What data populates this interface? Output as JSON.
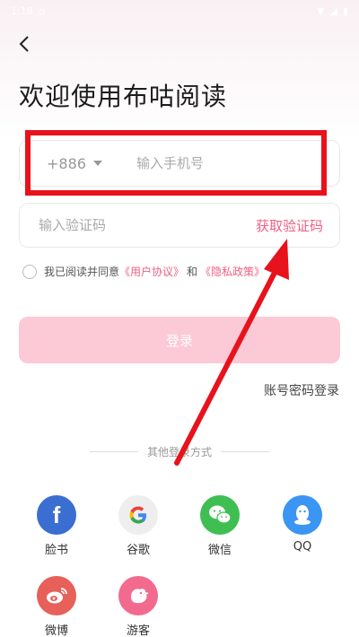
{
  "status_bar": {
    "time": "1:18"
  },
  "header": {
    "title": "欢迎使用布咕阅读"
  },
  "phone": {
    "country_code": "+886",
    "placeholder": "输入手机号"
  },
  "code": {
    "placeholder": "输入验证码",
    "get_code_label": "获取验证码"
  },
  "agreement": {
    "prefix": "我已阅读并同意",
    "user_agreement": "《用户协议》",
    "and": "和",
    "privacy_policy": "《隐私政策》"
  },
  "login_button": "登录",
  "password_login": "账号密码登录",
  "other_methods_label": "其他登录方式",
  "social": [
    {
      "name": "facebook-icon",
      "label": "脸书",
      "color": "#3b6ed1"
    },
    {
      "name": "google-icon",
      "label": "谷歌",
      "color": "#eeeeee"
    },
    {
      "name": "wechat-icon",
      "label": "微信",
      "color": "#3fbf52"
    },
    {
      "name": "qq-icon",
      "label": "QQ",
      "color": "#3a95f3"
    },
    {
      "name": "weibo-icon",
      "label": "微博",
      "color": "#e8605a"
    },
    {
      "name": "guest-icon",
      "label": "游客",
      "color": "#f26b8f"
    }
  ],
  "colors": {
    "accent": "#ee5f85",
    "annotation": "#e8121c",
    "button_disabled": "#fcc9d6"
  }
}
